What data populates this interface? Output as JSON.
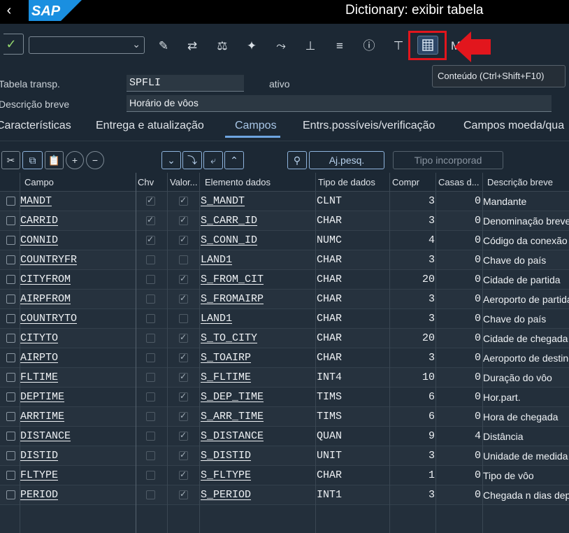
{
  "app": {
    "title": "Dictionary: exibir tabela",
    "back_icon": "‹",
    "logo": "SAP"
  },
  "toolbar": {
    "command_value": "",
    "buttons": [
      "change-icon",
      "switch-icon",
      "balance-icon",
      "magic-wand-icon",
      "where-used-icon",
      "hierarchy-icon",
      "stack-icon",
      "info-icon",
      "tree-icon"
    ],
    "content_button": "contents-table-icon",
    "more_label": "M",
    "tooltip": "Conteúdo    (Ctrl+Shift+F10)"
  },
  "header": {
    "table_label": "Tabela transp.",
    "table_value": "SPFLI",
    "status": "ativo",
    "desc_label": "Descrição breve",
    "desc_value": "Horário de vôos"
  },
  "tabs": [
    "Características",
    "Entrega e atualização",
    "Campos",
    "Entrs.possíveis/verificação",
    "Campos moeda/qua"
  ],
  "active_tab": "Campos",
  "grid_toolbar": {
    "search_help_label": "Aj.pesq.",
    "builtin_type_label": "Tipo incorporad"
  },
  "columns": [
    "Campo",
    "Chv",
    "Valor...",
    "Elemento dados",
    "Tipo de dados",
    "Compr",
    "Casas d...",
    "Descrição breve"
  ],
  "rows": [
    {
      "field": "MANDT",
      "key": true,
      "init": true,
      "element": "S_MANDT",
      "type": "CLNT",
      "len": "3",
      "dec": "0",
      "desc": "Mandante"
    },
    {
      "field": "CARRID",
      "key": true,
      "init": true,
      "element": "S_CARR_ID",
      "type": "CHAR",
      "len": "3",
      "dec": "0",
      "desc": "Denominação breve"
    },
    {
      "field": "CONNID",
      "key": true,
      "init": true,
      "element": "S_CONN_ID",
      "type": "NUMC",
      "len": "4",
      "dec": "0",
      "desc": "Código da conexão"
    },
    {
      "field": "COUNTRYFR",
      "key": false,
      "init": false,
      "element": "LAND1",
      "type": "CHAR",
      "len": "3",
      "dec": "0",
      "desc": "Chave do país"
    },
    {
      "field": "CITYFROM",
      "key": false,
      "init": true,
      "element": "S_FROM_CIT",
      "type": "CHAR",
      "len": "20",
      "dec": "0",
      "desc": "Cidade de partida"
    },
    {
      "field": "AIRPFROM",
      "key": false,
      "init": true,
      "element": "S_FROMAIRP",
      "type": "CHAR",
      "len": "3",
      "dec": "0",
      "desc": "Aeroporto de partida"
    },
    {
      "field": "COUNTRYTO",
      "key": false,
      "init": false,
      "element": "LAND1",
      "type": "CHAR",
      "len": "3",
      "dec": "0",
      "desc": "Chave do país"
    },
    {
      "field": "CITYTO",
      "key": false,
      "init": true,
      "element": "S_TO_CITY",
      "type": "CHAR",
      "len": "20",
      "dec": "0",
      "desc": "Cidade de chegada"
    },
    {
      "field": "AIRPTO",
      "key": false,
      "init": true,
      "element": "S_TOAIRP",
      "type": "CHAR",
      "len": "3",
      "dec": "0",
      "desc": "Aeroporto de destino"
    },
    {
      "field": "FLTIME",
      "key": false,
      "init": true,
      "element": "S_FLTIME",
      "type": "INT4",
      "len": "10",
      "dec": "0",
      "desc": "Duração do vôo"
    },
    {
      "field": "DEPTIME",
      "key": false,
      "init": true,
      "element": "S_DEP_TIME",
      "type": "TIMS",
      "len": "6",
      "dec": "0",
      "desc": "Hor.part."
    },
    {
      "field": "ARRTIME",
      "key": false,
      "init": true,
      "element": "S_ARR_TIME",
      "type": "TIMS",
      "len": "6",
      "dec": "0",
      "desc": "Hora de chegada"
    },
    {
      "field": "DISTANCE",
      "key": false,
      "init": true,
      "element": "S_DISTANCE",
      "type": "QUAN",
      "len": "9",
      "dec": "4",
      "desc": "Distância"
    },
    {
      "field": "DISTID",
      "key": false,
      "init": true,
      "element": "S_DISTID",
      "type": "UNIT",
      "len": "3",
      "dec": "0",
      "desc": "Unidade de medida"
    },
    {
      "field": "FLTYPE",
      "key": false,
      "init": true,
      "element": "S_FLTYPE",
      "type": "CHAR",
      "len": "1",
      "dec": "0",
      "desc": "Tipo de vôo"
    },
    {
      "field": "PERIOD",
      "key": false,
      "init": true,
      "element": "S_PERIOD",
      "type": "INT1",
      "len": "3",
      "dec": "0",
      "desc": "Chegada n dias depois"
    }
  ]
}
